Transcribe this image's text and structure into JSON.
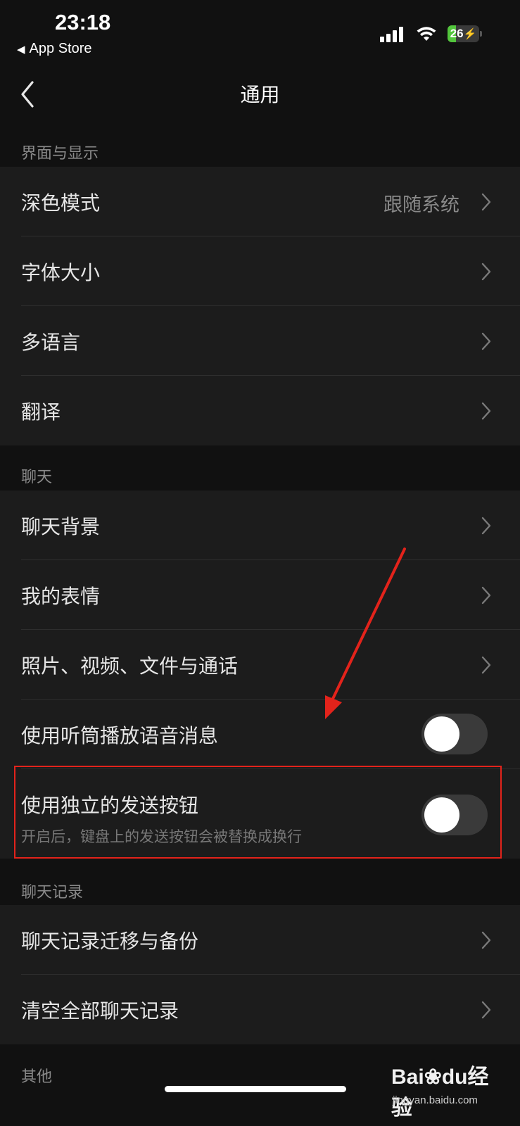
{
  "status_bar": {
    "time": "23:18",
    "back_app": "App Store",
    "battery_level": "26",
    "icons": [
      "signal-icon",
      "wifi-icon",
      "battery-charging-icon"
    ]
  },
  "nav": {
    "title": "通用",
    "back_icon": "chevron-left-icon"
  },
  "sections": {
    "display": {
      "header": "界面与显示",
      "dark_mode": {
        "label": "深色模式",
        "value": "跟随系统"
      },
      "font_size": {
        "label": "字体大小"
      },
      "language": {
        "label": "多语言"
      },
      "translate": {
        "label": "翻译"
      }
    },
    "chat": {
      "header": "聊天",
      "background": {
        "label": "聊天背景"
      },
      "stickers": {
        "label": "我的表情"
      },
      "media": {
        "label": "照片、视频、文件与通话"
      },
      "earpiece": {
        "label": "使用听筒播放语音消息",
        "enabled": false
      },
      "send_button": {
        "label": "使用独立的发送按钮",
        "sublabel": "开启后，键盘上的发送按钮会被替换成换行",
        "enabled": false
      }
    },
    "history": {
      "header": "聊天记录",
      "migrate": {
        "label": "聊天记录迁移与备份"
      },
      "clear": {
        "label": "清空全部聊天记录"
      }
    },
    "other": {
      "header": "其他"
    }
  },
  "annotation": {
    "highlight_color": "#e3231b"
  },
  "watermark": {
    "logo_text": "Bai du 经验",
    "logo_bai": "Bai",
    "logo_du": "du",
    "logo_jingyan": "经验",
    "site": "jingyan.baidu.com"
  },
  "colors": {
    "background": "#111111",
    "cell": "#1c1c1c",
    "text": "#e6e6e6",
    "secondary": "#8a8a8a",
    "toggle_off": "#3a3a3a",
    "battery": "#53c63d"
  }
}
